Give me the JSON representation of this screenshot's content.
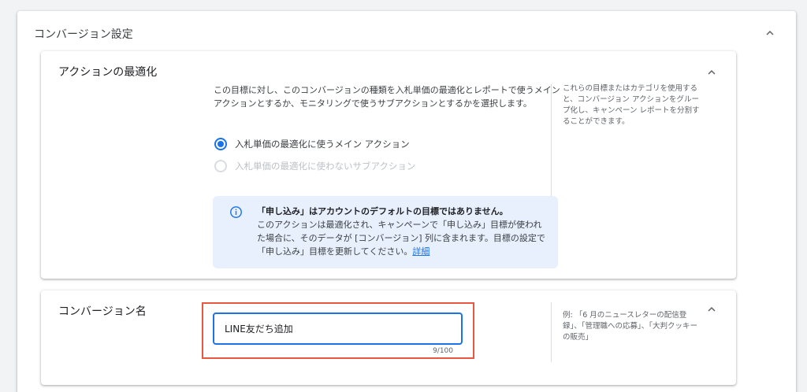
{
  "section": {
    "title": "コンバージョン設定"
  },
  "action_card": {
    "title": "アクションの最適化",
    "description": "この目標に対し、このコンバージョンの種類を入札単価の最適化とレポートで使うメイン アクションとするか、モニタリングで使うサブアクションとするかを選択します。",
    "options": [
      {
        "label": "入札単価の最適化に使うメイン アクション",
        "selected": true,
        "disabled": false
      },
      {
        "label": "入札単価の最適化に使わないサブアクション",
        "selected": false,
        "disabled": true
      }
    ],
    "info": {
      "title": "「申し込み」はアカウントのデフォルトの目標ではありません。",
      "body": "このアクションは最適化され、キャンペーンで「申し込み」目標が使われた場合に、そのデータが [コンバージョン] 列に含まれます。目標の設定で「申し込み」目標を更新してください。",
      "link": "詳細"
    },
    "help": "これらの目標またはカテゴリを使用すると、コンバージョン アクションをグループ化し、キャンペーン レポートを分割することができます。"
  },
  "name_card": {
    "title": "コンバージョン名",
    "input_value": "LINE友だち追加",
    "counter": "9/100",
    "help": "例: 「6 月のニュースレターの配信登録」、「管理職への応募」、「大判クッキーの販売」"
  },
  "colors": {
    "accent": "#1a73e8",
    "info_bg": "#e8f0fe",
    "highlight": "#e8573f"
  },
  "icons": [
    "chevron-up-icon",
    "info-icon",
    "radio-checked",
    "radio-unchecked"
  ]
}
